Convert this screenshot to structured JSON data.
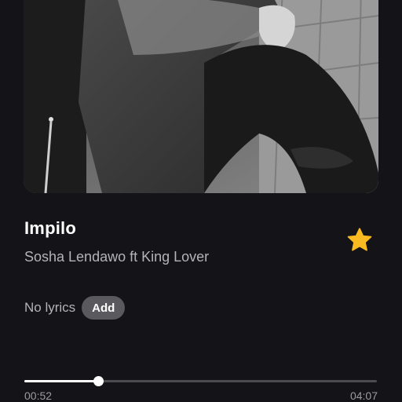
{
  "track": {
    "title": "Impilo",
    "artist_line": "Sosha Lendawo ft King Lover",
    "favorite_icon": "star-icon",
    "favorite_color": "#F9B921",
    "is_favorite": true
  },
  "lyrics": {
    "status_label": "No lyrics",
    "add_label": "Add"
  },
  "playback": {
    "elapsed": "00:52",
    "total": "04:07",
    "progress_fraction": 0.21
  },
  "artwork": {
    "description_icon": "album-art-image"
  }
}
